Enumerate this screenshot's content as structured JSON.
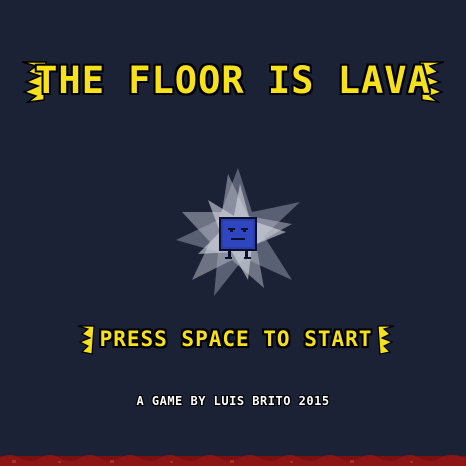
{
  "game": {
    "title": "THE FLOOR IS LAVA",
    "prompt": "PRESS SPACE TO START",
    "credits": "A GAME BY LUIS BRITO 2015"
  },
  "colors": {
    "background": "#1c2235",
    "title_yellow": "#f7e11a",
    "outline": "#000000",
    "player_blue": "#2a3ca8",
    "lava_red": "#7a1010"
  },
  "icons": {
    "player": "square-robot-character-icon",
    "glow": "star-burst-glow"
  }
}
